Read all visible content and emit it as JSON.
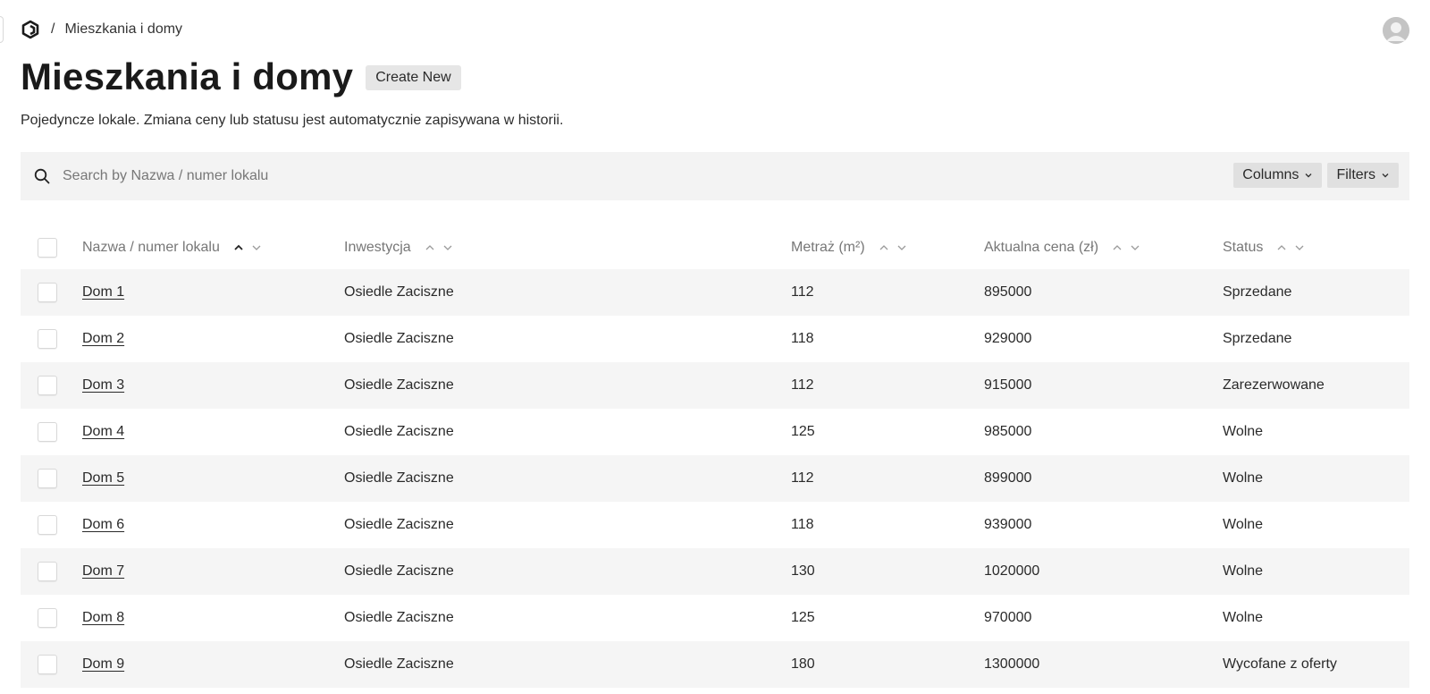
{
  "breadcrumb": {
    "separator": "/",
    "current": "Mieszkania i domy"
  },
  "page": {
    "title": "Mieszkania i domy",
    "create_label": "Create New",
    "description": "Pojedyncze lokale. Zmiana ceny lub statusu jest automatycznie zapisywana w historii."
  },
  "search": {
    "placeholder": "Search by Nazwa / numer lokalu",
    "value": ""
  },
  "toolbar": {
    "columns_label": "Columns",
    "filters_label": "Filters"
  },
  "table": {
    "headers": [
      "Nazwa / numer lokalu",
      "Inwestycja",
      "Metraż (m²)",
      "Aktualna cena (zł)",
      "Status"
    ],
    "sorted_column": 0,
    "sort_direction": "ascending",
    "rows": [
      [
        "Dom 1",
        "Osiedle Zaciszne",
        "112",
        "895000",
        "Sprzedane"
      ],
      [
        "Dom 2",
        "Osiedle Zaciszne",
        "118",
        "929000",
        "Sprzedane"
      ],
      [
        "Dom 3",
        "Osiedle Zaciszne",
        "112",
        "915000",
        "Zarezerwowane"
      ],
      [
        "Dom 4",
        "Osiedle Zaciszne",
        "125",
        "985000",
        "Wolne"
      ],
      [
        "Dom 5",
        "Osiedle Zaciszne",
        "112",
        "899000",
        "Wolne"
      ],
      [
        "Dom 6",
        "Osiedle Zaciszne",
        "118",
        "939000",
        "Wolne"
      ],
      [
        "Dom 7",
        "Osiedle Zaciszne",
        "130",
        "1020000",
        "Wolne"
      ],
      [
        "Dom 8",
        "Osiedle Zaciszne",
        "125",
        "970000",
        "Wolne"
      ],
      [
        "Dom 9",
        "Osiedle Zaciszne",
        "180",
        "1300000",
        "Wycofane z oferty"
      ]
    ]
  },
  "icons": {
    "logo": "brand-logo-icon",
    "avatar": "user-avatar",
    "search": "search-icon",
    "dropdown": "chevron-down-icon",
    "sort_up": "sort-ascending-icon",
    "sort_down": "sort-descending-icon"
  },
  "colors": {
    "row_shade": "#f5f5f5",
    "toolbar_bg": "#f3f3f3",
    "button_bg": "#e6e6e6"
  }
}
